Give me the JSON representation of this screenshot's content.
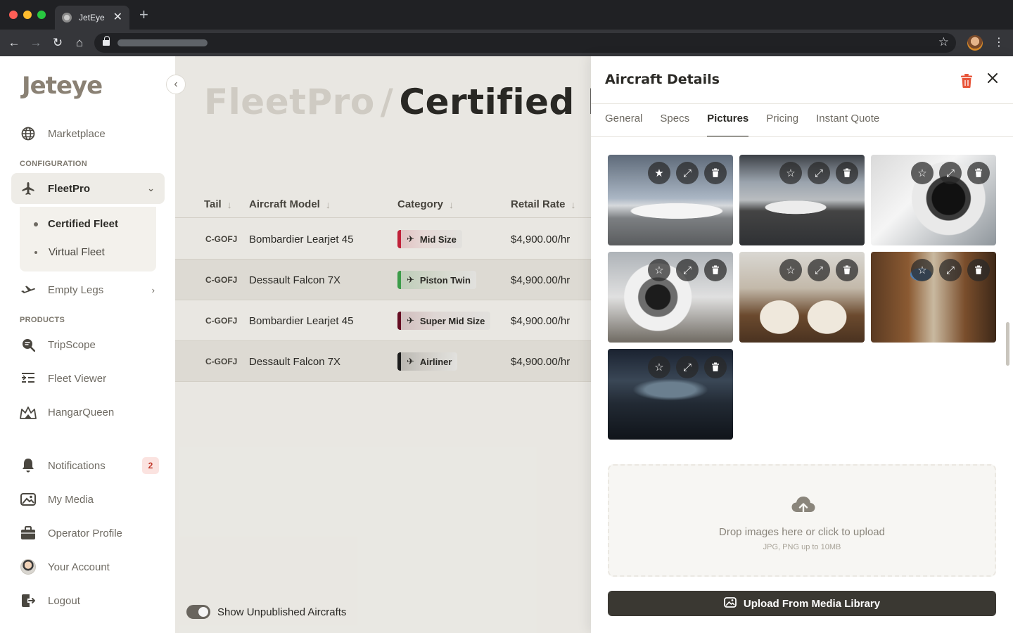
{
  "browser": {
    "tab_title": "JetEye",
    "new_tab": "+",
    "tab_close": "✕"
  },
  "sidebar": {
    "logo": "Jeteye",
    "marketplace": "Marketplace",
    "config_label": "CONFIGURATION",
    "fleetpro": "FleetPro",
    "certified_fleet": "Certified Fleet",
    "virtual_fleet": "Virtual Fleet",
    "empty_legs": "Empty Legs",
    "products_label": "PRODUCTS",
    "tripscope": "TripScope",
    "fleet_viewer": "Fleet Viewer",
    "hangarqueen": "HangarQueen",
    "notifications": "Notifications",
    "notifications_count": "2",
    "my_media": "My Media",
    "operator_profile": "Operator Profile",
    "your_account": "Your Account",
    "logout": "Logout"
  },
  "main": {
    "title_parent": "FleetPro",
    "title_separator": "/",
    "title_current": "Certified Fleet",
    "columns": {
      "tail": "Tail",
      "model": "Aircraft Model",
      "category": "Category",
      "rate": "Retail Rate"
    },
    "rows": [
      {
        "tail": "C-GOFJ",
        "model": "Bombardier Learjet 45",
        "category": "Mid Size",
        "category_color": "#c8233c",
        "rate": "$4,900.00/hr"
      },
      {
        "tail": "C-GOFJ",
        "model": "Dessault Falcon 7X",
        "category": "Piston Twin",
        "category_color": "#3fa34d",
        "rate": "$4,900.00/hr"
      },
      {
        "tail": "C-GOFJ",
        "model": "Bombardier Learjet 45",
        "category": "Super Mid Size",
        "category_color": "#6a0e24",
        "rate": "$4,900.00/hr"
      },
      {
        "tail": "C-GOFJ",
        "model": "Dessault Falcon 7X",
        "category": "Airliner",
        "category_color": "#1e1e1e",
        "rate": "$4,900.00/hr"
      }
    ],
    "toggle_label": "Show Unpublished Aircrafts",
    "toggle_on": true
  },
  "panel": {
    "title": "Aircraft Details",
    "tabs": [
      "General",
      "Specs",
      "Pictures",
      "Pricing",
      "Instant Quote"
    ],
    "active_tab": "Pictures",
    "pictures": [
      {
        "subject": "exterior-tarmac",
        "featured": true
      },
      {
        "subject": "exterior-hangar",
        "featured": false
      },
      {
        "subject": "engine-closeup",
        "featured": false
      },
      {
        "subject": "engine-side",
        "featured": false
      },
      {
        "subject": "cabin-seats",
        "featured": false
      },
      {
        "subject": "cabin-wood",
        "featured": false
      },
      {
        "subject": "cockpit",
        "featured": false
      }
    ],
    "dropzone_text": "Drop images here or click to upload",
    "dropzone_hint": "JPG, PNG up to 10MB",
    "upload_button": "Upload From Media Library"
  },
  "colors": {
    "accent_dark": "#3a3832",
    "danger": "#e8553a"
  }
}
